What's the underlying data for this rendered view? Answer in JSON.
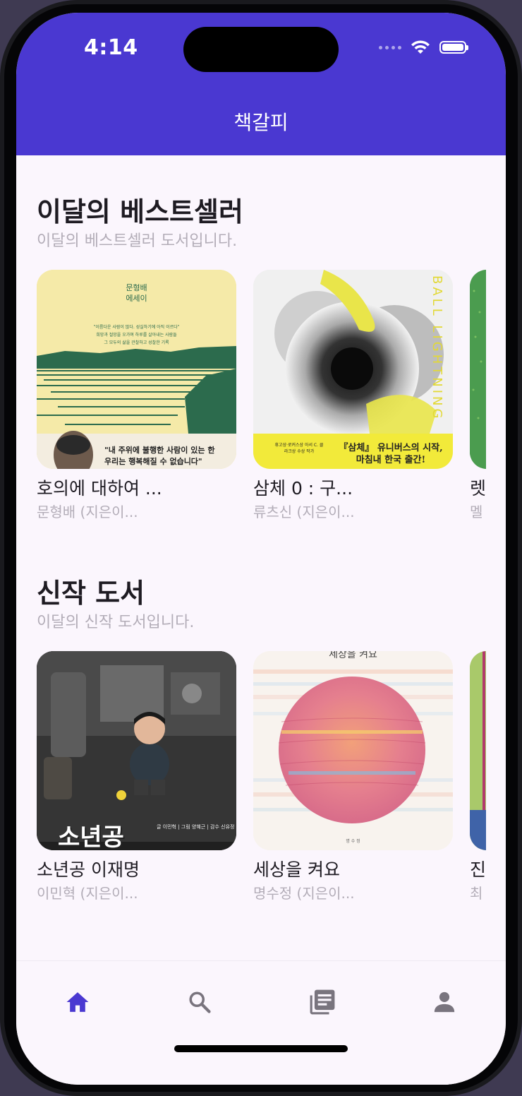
{
  "status_bar": {
    "time": "4:14"
  },
  "app": {
    "title": "책갈피"
  },
  "sections": [
    {
      "title": "이달의 베스트셀러",
      "subtitle": "이달의 베스트셀러 도서입니다.",
      "books": [
        {
          "title": "호의에 대하여 ...",
          "author": "문형배 (지은이...",
          "cover_text": {
            "author": "문형배",
            "genre": "에세이",
            "quote1": "\"이름다운 사람이 많다. 성실하기에 아직 이르다\"",
            "quote2": "희망과 절망을 오가며 하루를 살아내는 사람들",
            "quote3": "그 모두의 삶을 관찰하고 성찰한 기록",
            "tagline1": "\"내 주위에 불행한 사람이 있는 한",
            "tagline2": "우리는 행복해질 수 없습니다\""
          }
        },
        {
          "title": "삼체 0 : 구...",
          "author": "류츠신 (지은이...",
          "cover_text": {
            "spine": "BALL LIGHTNING",
            "award": "휴고상·로커스상 아서 C. 클라크상 수상 작가",
            "banner1": "『삼체』 유니버스의 시작,",
            "banner2": "마침내 한국 출간!"
          }
        },
        {
          "title": "렛",
          "author": "멜"
        }
      ]
    },
    {
      "title": "신작 도서",
      "subtitle": "이달의 신작 도서입니다.",
      "books": [
        {
          "title": "소년공 이재명",
          "author": "이민혁 (지은이...",
          "cover_text": {
            "big": "소년공",
            "credits": "글 이민혁 | 그림 양혜근 | 감수 신유정"
          }
        },
        {
          "title": "세상을 켜요",
          "author": "명수정 (지은이...",
          "cover_text": {
            "top": "세상을 켜요",
            "bottom": "명 수 정"
          }
        },
        {
          "title": "진",
          "author": "최"
        }
      ]
    }
  ],
  "bottom_nav": [
    {
      "name": "home",
      "active": true
    },
    {
      "name": "search",
      "active": false
    },
    {
      "name": "library",
      "active": false
    },
    {
      "name": "profile",
      "active": false
    }
  ],
  "colors": {
    "primary": "#4a38d1",
    "background": "#fbf6fd",
    "inactive": "#79747e"
  }
}
